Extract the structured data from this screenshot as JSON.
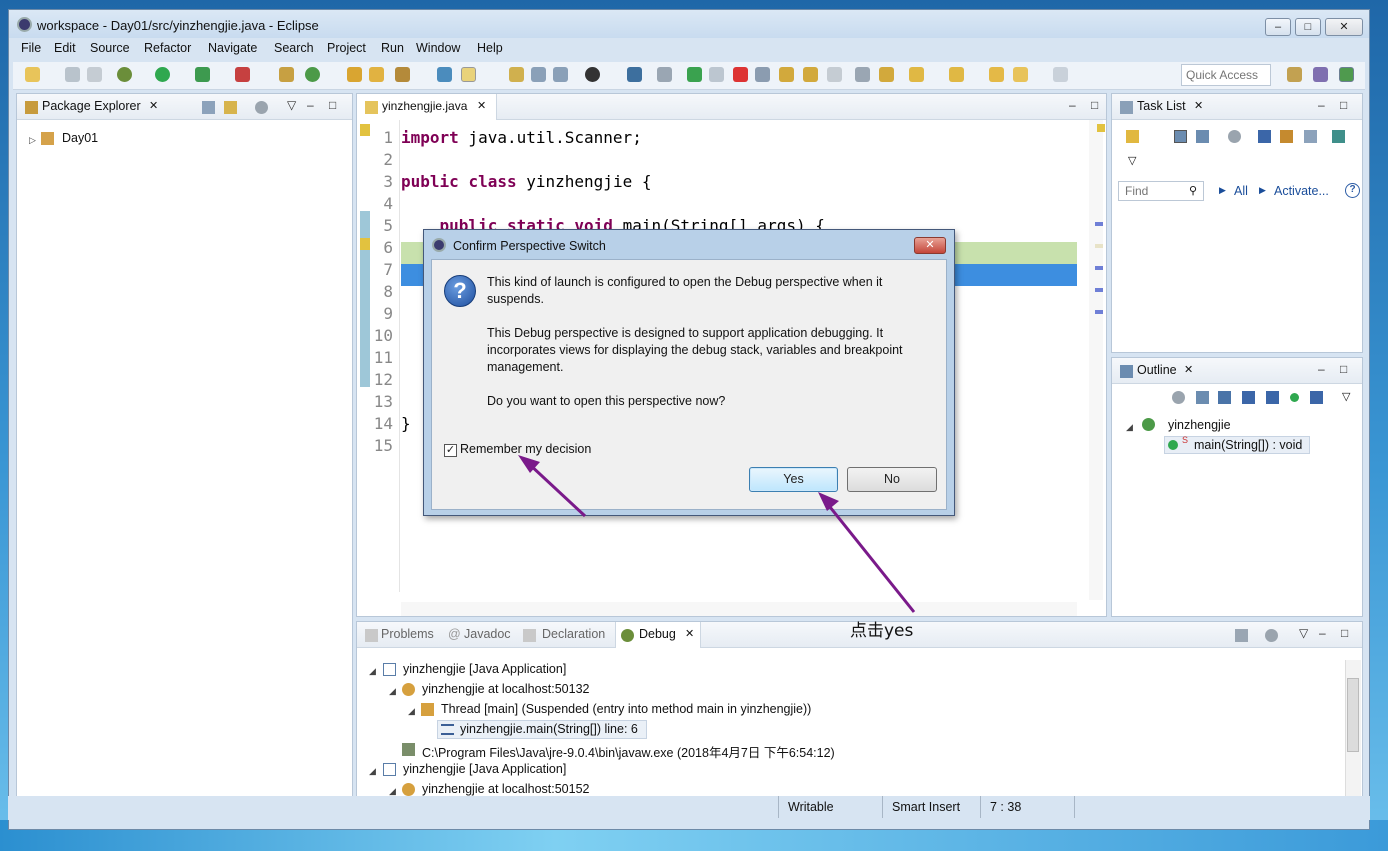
{
  "window": {
    "title": "workspace - Day01/src/yinzhengjie.java - Eclipse",
    "min": "–",
    "max": "□",
    "close": "✕"
  },
  "menu": [
    "File",
    "Edit",
    "Source",
    "Refactor",
    "Navigate",
    "Search",
    "Project",
    "Run",
    "Window",
    "Help"
  ],
  "toolbar": {
    "quick_access": "Quick Access"
  },
  "package_explorer": {
    "tab": "Package Explorer",
    "project": "Day01"
  },
  "editor": {
    "tab": "yinzhengjie.java",
    "lines": [
      {
        "n": "1",
        "parts": [
          [
            "kw",
            "import"
          ],
          [
            "t",
            " java.util.Scanner;"
          ]
        ]
      },
      {
        "n": "2",
        "parts": []
      },
      {
        "n": "3",
        "parts": [
          [
            "kw",
            "public"
          ],
          [
            "t",
            " "
          ],
          [
            "kw",
            "class"
          ],
          [
            "t",
            " yinzhengjie {"
          ]
        ]
      },
      {
        "n": "4",
        "parts": []
      },
      {
        "n": "5",
        "parts": [
          [
            "t",
            "    "
          ],
          [
            "kw",
            "public"
          ],
          [
            "t",
            " "
          ],
          [
            "kw",
            "static"
          ],
          [
            "t",
            " "
          ],
          [
            "kw",
            "void"
          ],
          [
            "t",
            " main(String[] args) {"
          ]
        ]
      },
      {
        "n": "6",
        "parts": []
      },
      {
        "n": "7",
        "parts": []
      },
      {
        "n": "8",
        "parts": []
      },
      {
        "n": "9",
        "parts": []
      },
      {
        "n": "10",
        "parts": []
      },
      {
        "n": "11",
        "parts": []
      },
      {
        "n": "12",
        "parts": []
      },
      {
        "n": "13",
        "parts": []
      },
      {
        "n": "14",
        "parts": [
          [
            "t",
            "}"
          ]
        ]
      },
      {
        "n": "15",
        "parts": []
      }
    ]
  },
  "task_list": {
    "tab": "Task List",
    "find_placeholder": "Find",
    "all": "All",
    "activate": "Activate..."
  },
  "outline": {
    "tab": "Outline",
    "class": "yinzhengjie",
    "method": "main(String[]) : void"
  },
  "bottom_tabs": {
    "problems": "Problems",
    "javadoc": "Javadoc",
    "declaration": "Declaration",
    "debug": "Debug"
  },
  "debug_tree": [
    "yinzhengjie [Java Application]",
    "yinzhengjie at localhost:50132",
    "Thread [main] (Suspended (entry into method main in yinzhengjie))",
    "yinzhengjie.main(String[]) line: 6",
    "C:\\Program Files\\Java\\jre-9.0.4\\bin\\javaw.exe (2018年4月7日 下午6:54:12)",
    "yinzhengjie [Java Application]",
    "yinzhengjie at localhost:50152"
  ],
  "dialog": {
    "title": "Confirm Perspective Switch",
    "para1": "This kind of launch is configured to open the Debug perspective when it suspends.",
    "para2": "This Debug perspective is designed to support application debugging.  It incorporates views for displaying the debug stack, variables and breakpoint management.",
    "para3": "Do you want to open this perspective now?",
    "remember": "Remember my decision",
    "remember_checked": true,
    "yes": "Yes",
    "no": "No"
  },
  "annotation": "点击yes",
  "status": {
    "writable": "Writable",
    "insert": "Smart Insert",
    "position": "7 : 38"
  },
  "colors": {
    "arrow": "#7a1a8a",
    "keyword": "#7f0055"
  }
}
